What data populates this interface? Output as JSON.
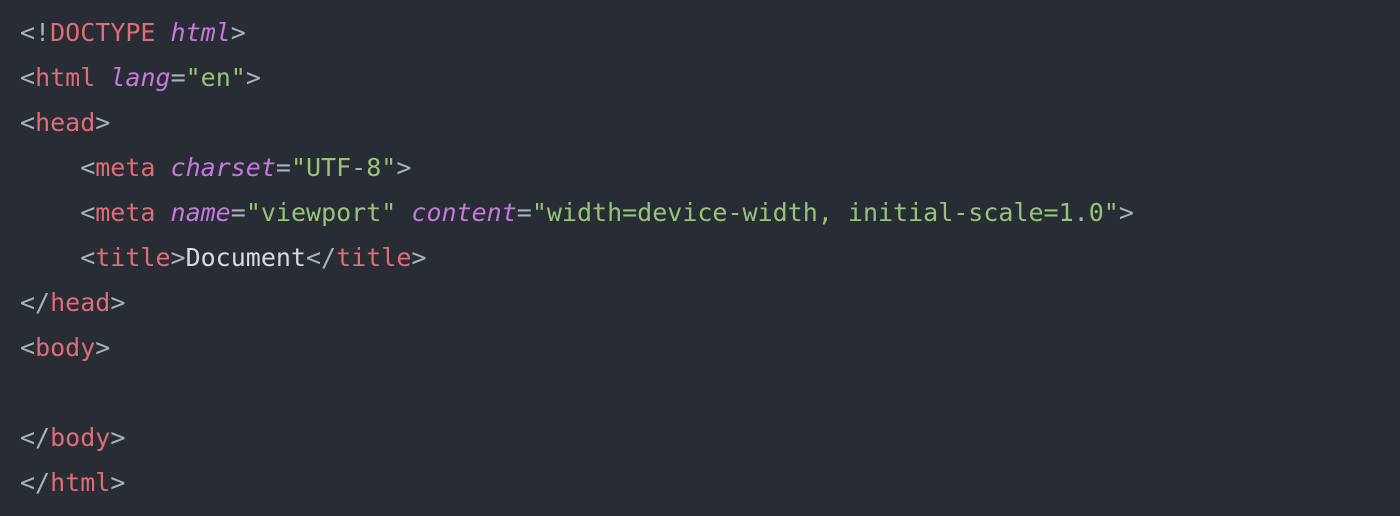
{
  "code": {
    "doctype": {
      "open": "<!",
      "name": "DOCTYPE",
      "space": " ",
      "attr": "html",
      "close": ">"
    },
    "html_open": {
      "open": "<",
      "tag": "html",
      "space": " ",
      "attr_name": "lang",
      "eq": "=",
      "attr_val": "\"en\"",
      "close": ">"
    },
    "head_open": {
      "open": "<",
      "tag": "head",
      "close": ">"
    },
    "meta1": {
      "open": "<",
      "tag": "meta",
      "space": " ",
      "attr1_name": "charset",
      "eq1": "=",
      "attr1_val": "\"UTF-8\"",
      "close": ">"
    },
    "meta2": {
      "open": "<",
      "tag": "meta",
      "space1": " ",
      "attr1_name": "name",
      "eq1": "=",
      "attr1_val": "\"viewport\"",
      "space2": " ",
      "attr2_name": "content",
      "eq2": "=",
      "attr2_val": "\"width=device-width, initial-scale=1.0\"",
      "close": ">"
    },
    "title": {
      "open1": "<",
      "tag1": "title",
      "close1": ">",
      "text": "Document",
      "open2": "</",
      "tag2": "title",
      "close2": ">"
    },
    "head_close": {
      "open": "</",
      "tag": "head",
      "close": ">"
    },
    "body_open": {
      "open": "<",
      "tag": "body",
      "close": ">"
    },
    "body_close": {
      "open": "</",
      "tag": "body",
      "close": ">"
    },
    "html_close": {
      "open": "</",
      "tag": "html",
      "close": ">"
    }
  }
}
